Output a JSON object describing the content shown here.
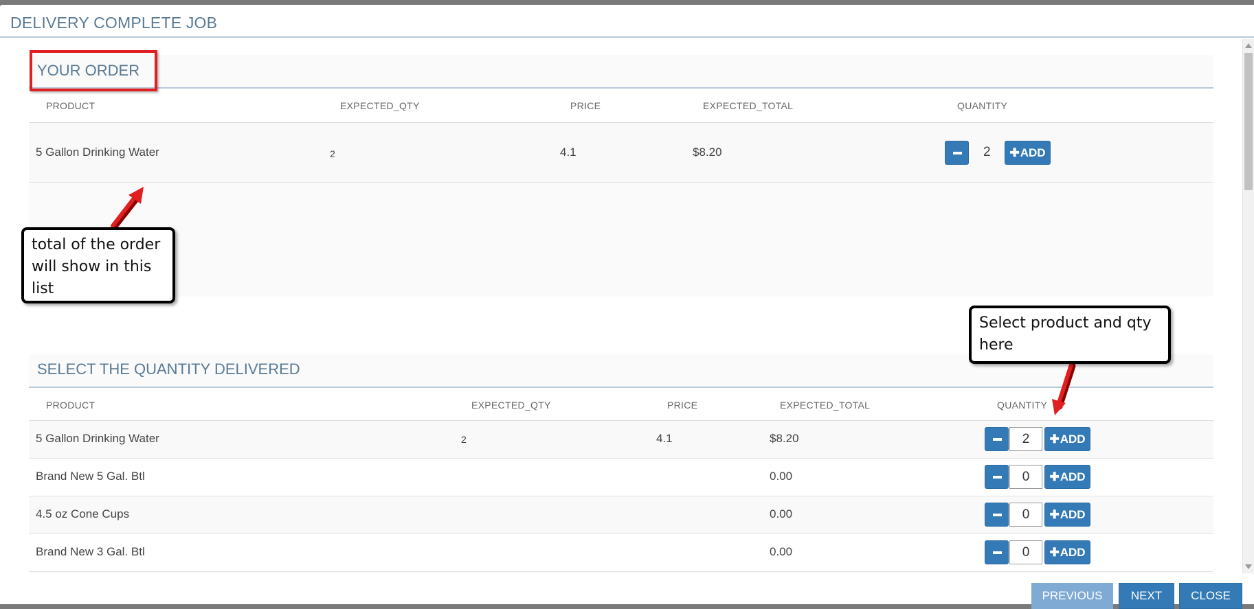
{
  "modal": {
    "title": "DELIVERY COMPLETE JOB"
  },
  "your_order": {
    "title": "YOUR ORDER",
    "headers": [
      "PRODUCT",
      "EXPECTED_QTY",
      "PRICE",
      "EXPECTED_TOTAL",
      "QUANTITY"
    ],
    "rows": [
      {
        "product": "5 Gallon Drinking Water",
        "expected_qty": "2",
        "price": "4.1",
        "expected_total": "$8.20",
        "quantity": "2"
      }
    ],
    "add_label": "ADD"
  },
  "select_quantity": {
    "title": "SELECT THE QUANTITY DELIVERED",
    "headers": [
      "PRODUCT",
      "EXPECTED_QTY",
      "PRICE",
      "EXPECTED_TOTAL",
      "QUANTITY"
    ],
    "rows": [
      {
        "product": "5 Gallon Drinking Water",
        "expected_qty": "2",
        "price": "4.1",
        "expected_total": "$8.20",
        "quantity": "2"
      },
      {
        "product": "Brand New 5 Gal. Btl",
        "expected_qty": "",
        "price": "",
        "expected_total": "0.00",
        "quantity": "0"
      },
      {
        "product": "4.5 oz Cone Cups",
        "expected_qty": "",
        "price": "",
        "expected_total": "0.00",
        "quantity": "0"
      },
      {
        "product": "Brand New 3 Gal. Btl",
        "expected_qty": "",
        "price": "",
        "expected_total": "0.00",
        "quantity": "0"
      }
    ],
    "add_label": "ADD"
  },
  "callouts": {
    "order_total": "total of the order will show in this list",
    "select_product": "Select product and qty here"
  },
  "footer": {
    "previous": "PREVIOUS",
    "next": "NEXT",
    "close": "CLOSE"
  },
  "colors": {
    "primary": "#337ab7",
    "title": "#5a7a95",
    "annotation_red": "#e02020"
  }
}
